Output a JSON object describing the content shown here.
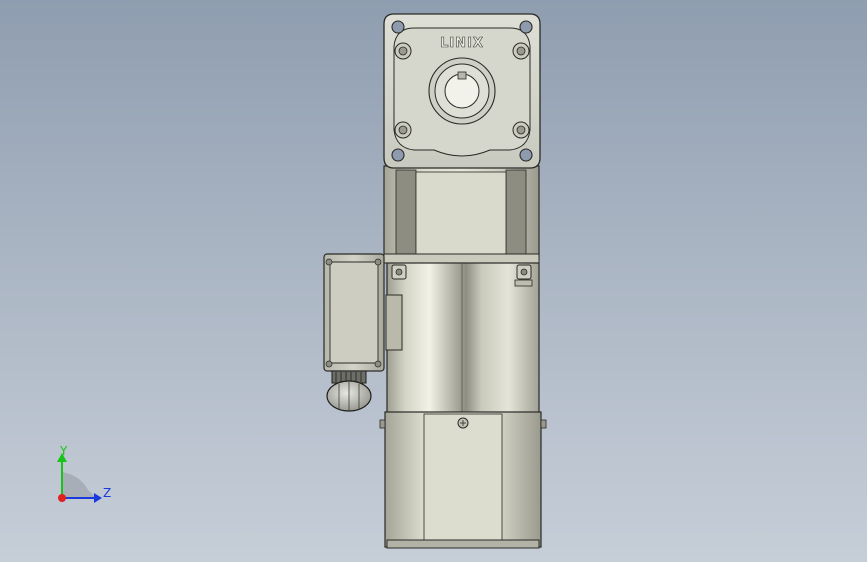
{
  "model": {
    "brand_label": "LINIX"
  },
  "triad": {
    "y_label": "Y",
    "z_label": "Z",
    "colors": {
      "y": "#19c419",
      "z": "#1a3adc",
      "x": "#e02020",
      "plane": "#a8aeb8"
    }
  }
}
